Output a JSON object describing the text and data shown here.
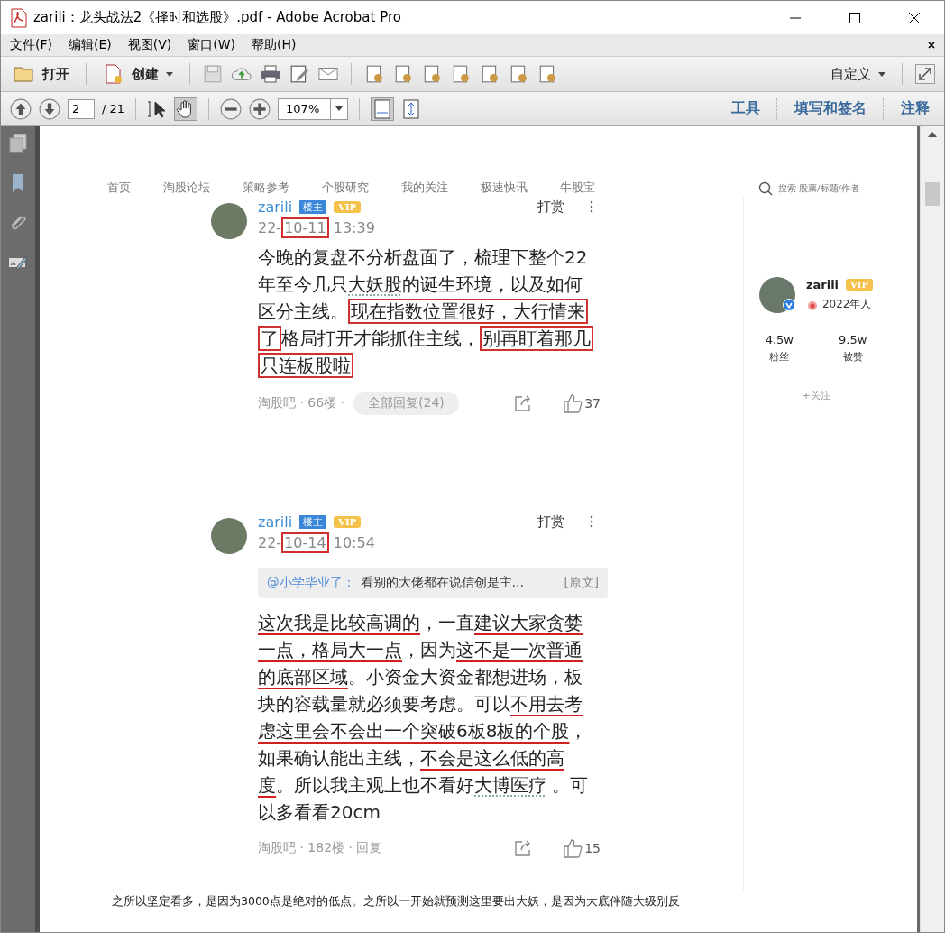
{
  "window": {
    "title": "zarili：龙头战法2《择时和选股》.pdf - Adobe Acrobat Pro"
  },
  "menu": [
    {
      "label": "文件(F)"
    },
    {
      "label": "编辑(E)"
    },
    {
      "label": "视图(V)"
    },
    {
      "label": "窗口(W)"
    },
    {
      "label": "帮助(H)"
    }
  ],
  "toolbar": {
    "open": "打开",
    "create": "创建",
    "customize": "自定义"
  },
  "nav_toolbar": {
    "page": "2",
    "page_total": "/ 21",
    "zoom": "107%",
    "panels": [
      {
        "label": "工具"
      },
      {
        "label": "填写和签名"
      },
      {
        "label": "注释"
      }
    ]
  },
  "forum": {
    "nav": [
      "首页",
      "淘股论坛",
      "策略参考",
      "个股研究",
      "我的关注",
      "极速快讯",
      "牛股宝"
    ],
    "search_placeholder": "搜索 股票/标题/作者",
    "posts": [
      {
        "author": "zarili",
        "role_badge": "楼主",
        "vip_badge": "VIP",
        "tip": "打赏",
        "date": [
          {
            "text": "22-",
            "kind": "plain"
          },
          {
            "text": "10-11",
            "kind": "boxed"
          },
          {
            "text": " 13:39",
            "kind": "plain"
          }
        ],
        "body": [
          {
            "text": "今晚的复盘不分析盘面了，梳理下整个22年至今几只",
            "kind": "plain"
          },
          {
            "text": "大妖股",
            "kind": "dotted"
          },
          {
            "text": "的诞生环境，以及如何区分主线。",
            "kind": "plain"
          },
          {
            "text": "现在指数位置很好，大行情来了",
            "kind": "boxed"
          },
          {
            "text": "格局打开才能抓住主线，",
            "kind": "plain"
          },
          {
            "text": "别再盯着那几只连板股啦",
            "kind": "boxed"
          }
        ],
        "meta": "淘股吧 · 66楼 ·",
        "replies_button": "全部回复(24)",
        "likes": "37"
      },
      {
        "author": "zarili",
        "role_badge": "楼主",
        "vip_badge": "VIP",
        "tip": "打赏",
        "date": [
          {
            "text": "22-",
            "kind": "plain"
          },
          {
            "text": "10-14",
            "kind": "boxed"
          },
          {
            "text": " 10:54",
            "kind": "plain"
          }
        ],
        "quote": {
          "user": "@小学毕业了：",
          "text": "看别的大佬都在说信创是主…",
          "link": "[原文]"
        },
        "body": [
          {
            "text": "这次我是比较高调的",
            "kind": "underlined"
          },
          {
            "text": "，一直",
            "kind": "plain"
          },
          {
            "text": "建议大家贪婪一点，格局大一点",
            "kind": "underlined"
          },
          {
            "text": "，因为",
            "kind": "plain"
          },
          {
            "text": "这不是一次普通的底部区域",
            "kind": "underlined"
          },
          {
            "text": "。小资金大资金都想进场，板块的容载量就必须要考虑。可以",
            "kind": "plain"
          },
          {
            "text": "不用去考虑这里会不会出一个突破6板8板的个股",
            "kind": "underlined"
          },
          {
            "text": "，如果确认能出主线，",
            "kind": "plain"
          },
          {
            "text": "不会是这么低的高度",
            "kind": "underlined"
          },
          {
            "text": "。所以我主观上也不看好",
            "kind": "plain"
          },
          {
            "text": "大博医疗",
            "kind": "dotted"
          },
          {
            "text": " 。可以多看看20cm",
            "kind": "plain"
          }
        ],
        "meta": "淘股吧 · 182楼 · 回复",
        "likes": "15"
      }
    ],
    "profile": {
      "name": "zarili",
      "vip_badge": "VIP",
      "honor": "2022年人",
      "stats": [
        {
          "value": "4.5w",
          "label": "粉丝"
        },
        {
          "value": "9.5w",
          "label": "被赞"
        }
      ],
      "follow": "+关注"
    },
    "paragraph": "之所以坚定看多，是因为3000点是绝对的低点。之所以一开始就预测这里要出大妖，是因为大底伴随大级别反"
  }
}
